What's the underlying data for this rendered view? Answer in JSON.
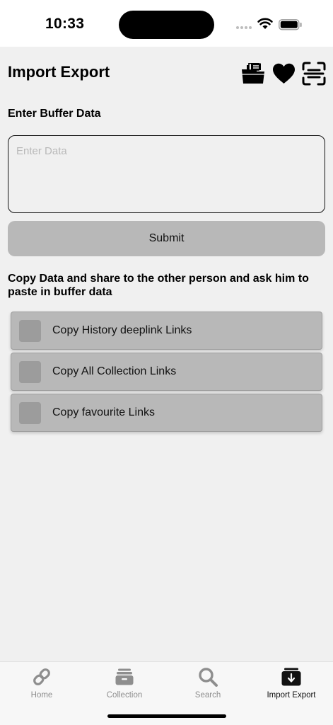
{
  "status_bar": {
    "time": "10:33"
  },
  "header": {
    "title": "Import Export",
    "actions": [
      {
        "icon": "folder-documents-icon"
      },
      {
        "icon": "heart-icon"
      },
      {
        "icon": "scan-icon"
      }
    ]
  },
  "buffer": {
    "label": "Enter Buffer Data",
    "placeholder": "Enter Data",
    "value": "",
    "submit_label": "Submit"
  },
  "instruction": "Copy Data and share to the other person and ask him to paste in buffer data",
  "copy_options": [
    {
      "label": "Copy History deeplink Links",
      "checked": false
    },
    {
      "label": "Copy All Collection Links",
      "checked": false
    },
    {
      "label": "Copy favourite Links",
      "checked": false
    }
  ],
  "tab_bar": {
    "tabs": [
      {
        "label": "Home",
        "icon": "link-icon",
        "active": false
      },
      {
        "label": "Collection",
        "icon": "archive-icon",
        "active": false
      },
      {
        "label": "Search",
        "icon": "search-icon",
        "active": false
      },
      {
        "label": "Import Export",
        "icon": "import-export-icon",
        "active": true
      }
    ]
  },
  "colors": {
    "background": "#f0f0f0",
    "button": "#b8b8b8",
    "checkbox": "#9c9c9c",
    "tab_inactive": "#8e8e8e",
    "tab_active": "#111111"
  }
}
